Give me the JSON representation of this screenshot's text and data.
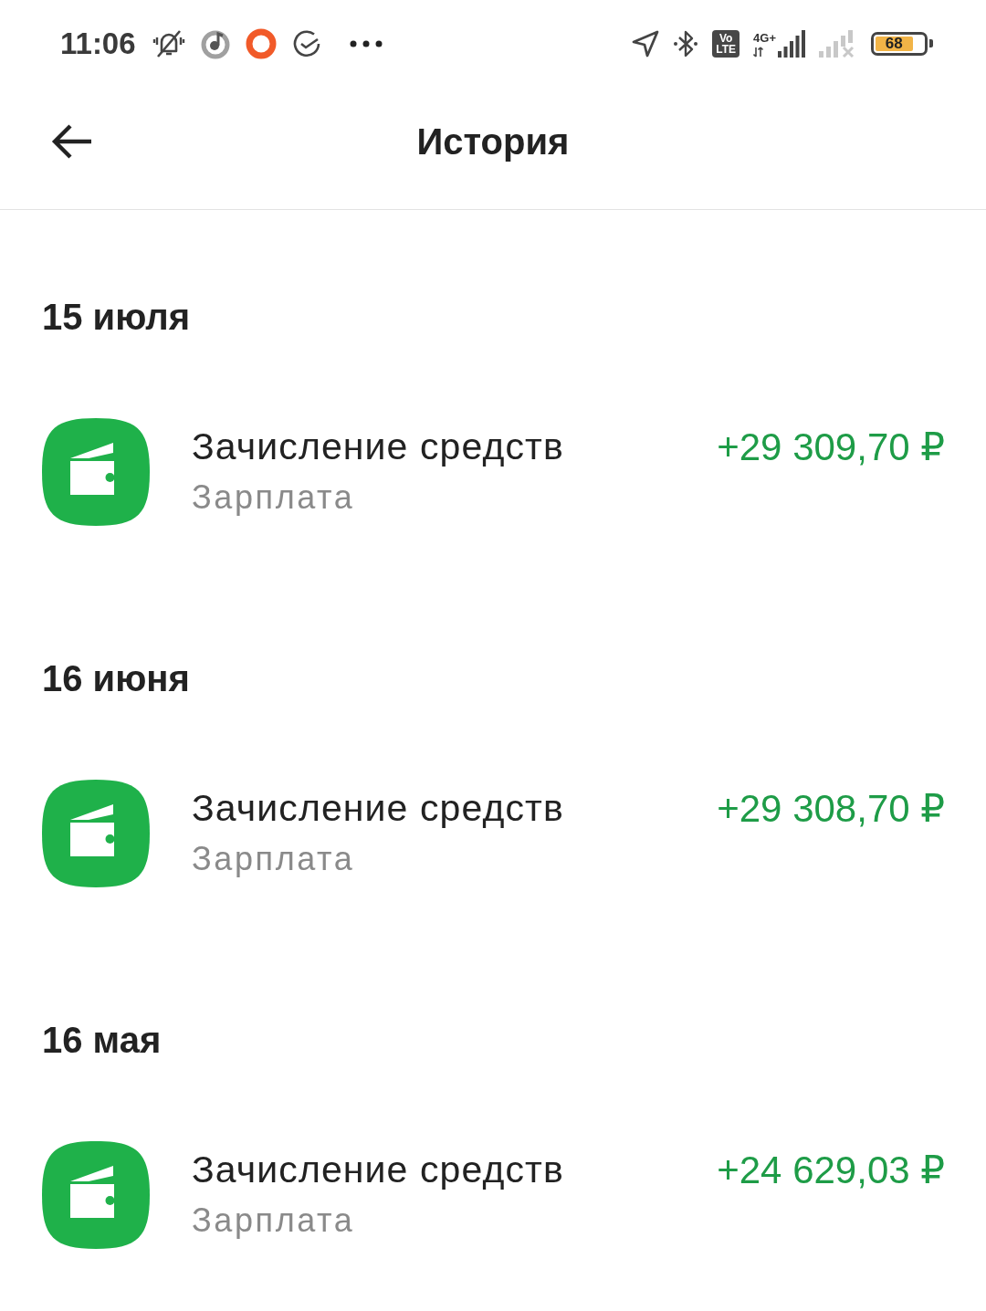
{
  "status_bar": {
    "time": "11:06",
    "volte": "Vo LTE",
    "network": "4G+",
    "battery": "68"
  },
  "header": {
    "title": "История"
  },
  "sections": [
    {
      "date": "15 июля",
      "transactions": [
        {
          "title": "Зачисление средств",
          "subtitle": "Зарплата",
          "amount": "+29 309,70 ₽"
        }
      ]
    },
    {
      "date": "16 июня",
      "transactions": [
        {
          "title": "Зачисление средств",
          "subtitle": "Зарплата",
          "amount": "+29 308,70 ₽"
        }
      ]
    },
    {
      "date": "16 мая",
      "transactions": [
        {
          "title": "Зачисление средств",
          "subtitle": "Зарплата",
          "amount": "+24 629,03 ₽"
        }
      ]
    }
  ]
}
